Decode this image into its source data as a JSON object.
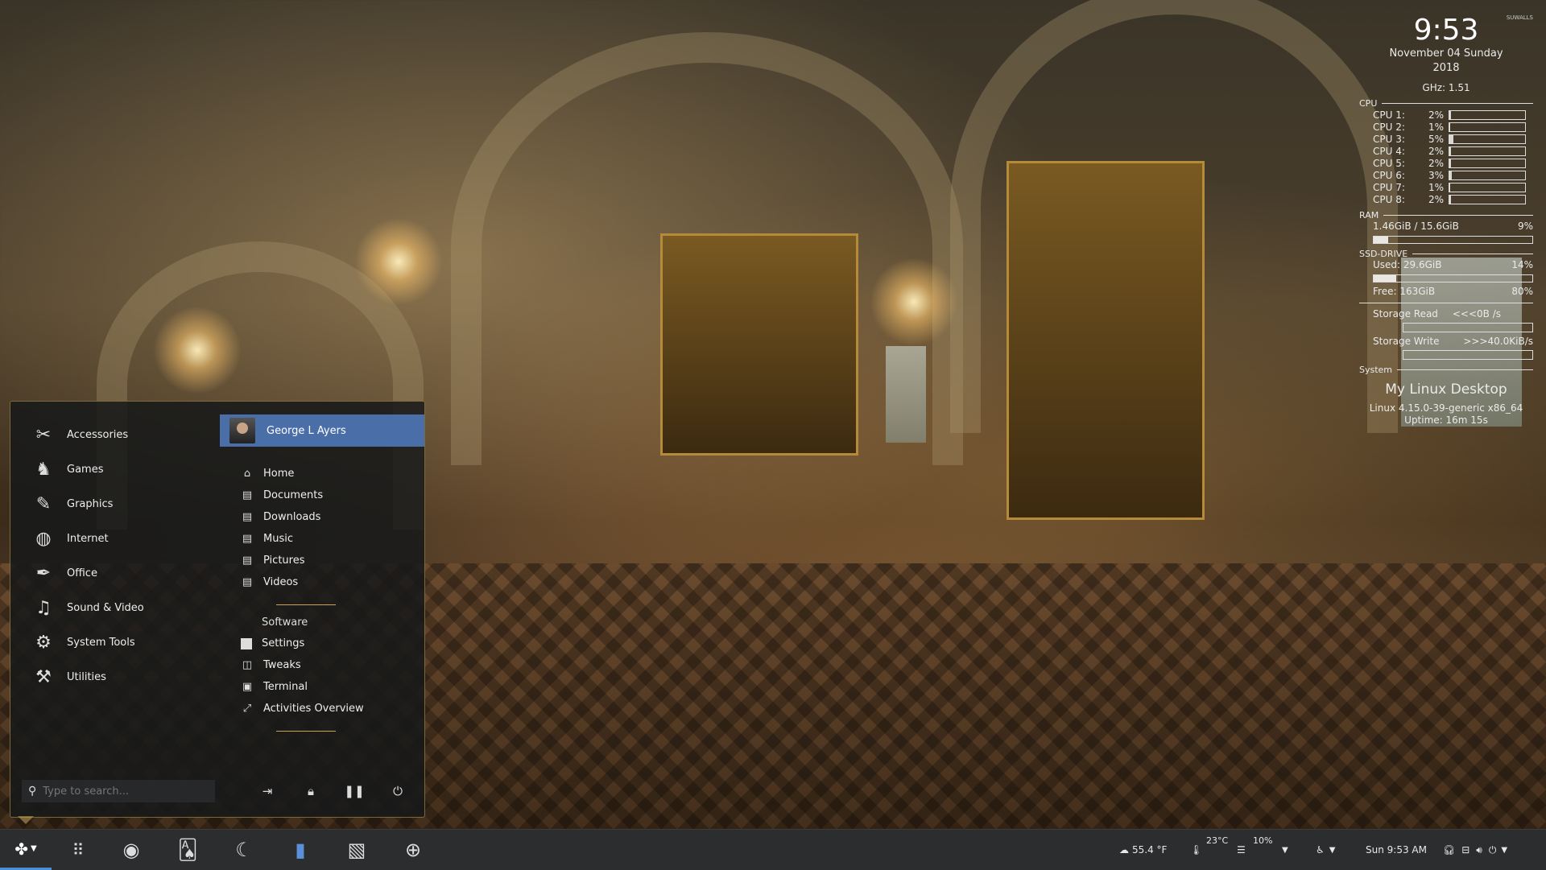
{
  "conky": {
    "brand": "SUWALLS",
    "time": "9:53",
    "date": "November 04 Sunday",
    "year": "2018",
    "ghz": "GHz: 1.51",
    "cpu_header": "CPU",
    "cpus": [
      {
        "label": "CPU 1:",
        "pct": "2%",
        "load": 0.02
      },
      {
        "label": "CPU 2:",
        "pct": "1%",
        "load": 0.01
      },
      {
        "label": "CPU 3:",
        "pct": "5%",
        "load": 0.05
      },
      {
        "label": "CPU 4:",
        "pct": "2%",
        "load": 0.02
      },
      {
        "label": "CPU 5:",
        "pct": "2%",
        "load": 0.02
      },
      {
        "label": "CPU 6:",
        "pct": "3%",
        "load": 0.03
      },
      {
        "label": "CPU 7:",
        "pct": "1%",
        "load": 0.01
      },
      {
        "label": "CPU 8:",
        "pct": "2%",
        "load": 0.02
      }
    ],
    "ram_header": "RAM",
    "ram_value": "1.46GiB / 15.6GiB",
    "ram_pct": "9%",
    "ram_load": 0.09,
    "ssd_header": "SSD-DRIVE",
    "ssd_used": "Used: 29.6GiB",
    "ssd_used_pct": "14%",
    "ssd_used_load": 0.14,
    "ssd_free": "Free: 163GiB",
    "ssd_free_pct": "80%",
    "storage_read_label": "Storage Read",
    "storage_read_value": "<<<0B /s",
    "storage_write_label": "Storage Write",
    "storage_write_value": ">>>40.0KiB/s",
    "system_header": "System",
    "desktop_title": "My Linux Desktop",
    "kernel": "Linux 4.15.0-39-generic x86_64",
    "uptime": "Uptime: 16m 15s"
  },
  "menu": {
    "categories": [
      {
        "label": "Accessories",
        "icon": "accessories-icon"
      },
      {
        "label": "Games",
        "icon": "games-icon"
      },
      {
        "label": "Graphics",
        "icon": "graphics-icon"
      },
      {
        "label": "Internet",
        "icon": "internet-icon"
      },
      {
        "label": "Office",
        "icon": "office-icon"
      },
      {
        "label": "Sound & Video",
        "icon": "sound-video-icon"
      },
      {
        "label": "System Tools",
        "icon": "system-tools-icon"
      },
      {
        "label": "Utilities",
        "icon": "utilities-icon"
      }
    ],
    "user": "George L Ayers",
    "places": [
      "Home",
      "Documents",
      "Downloads",
      "Music",
      "Pictures",
      "Videos"
    ],
    "software_label": "Software",
    "system_items": [
      "Settings",
      "Tweaks",
      "Terminal",
      "Activities Overview"
    ],
    "search_placeholder": "Type to search..."
  },
  "taskbar": {
    "weather": "55.4 °F",
    "temperature": "23°C",
    "disk_pct": "10%",
    "clock": "Sun  9:53 AM"
  }
}
